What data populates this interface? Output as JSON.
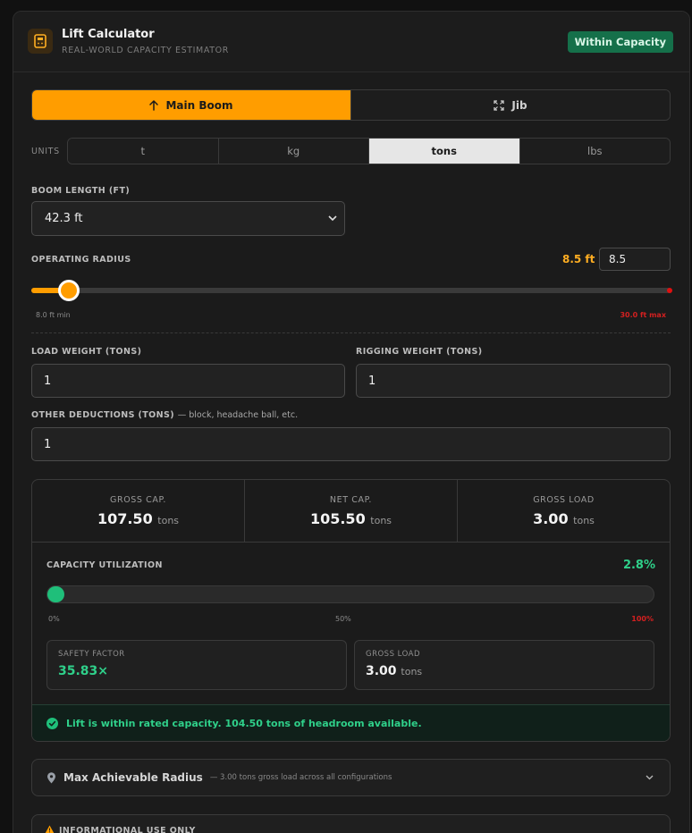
{
  "header": {
    "title": "Lift Calculator",
    "subtitle": "REAL-WORLD CAPACITY ESTIMATOR",
    "status": "Within Capacity"
  },
  "modes": [
    {
      "label": "Main Boom",
      "icon": "arrow-up-icon",
      "active": true
    },
    {
      "label": "Jib",
      "icon": "expand-icon",
      "active": false
    }
  ],
  "units": {
    "label": "UNITS",
    "options": [
      "t",
      "kg",
      "tons",
      "lbs"
    ],
    "selected": "tons"
  },
  "boom": {
    "label": "BOOM LENGTH (FT)",
    "value": "42.3 ft"
  },
  "radius": {
    "label": "OPERATING RADIUS",
    "display": "8.5 ft",
    "input_value": "8.5",
    "min_label": "8.0 ft min",
    "max_label": "30.0 ft max",
    "min": 8.0,
    "max": 30.0,
    "value": 8.5
  },
  "load": {
    "label": "LOAD WEIGHT (TONS)",
    "value": "1"
  },
  "rigging": {
    "label": "RIGGING WEIGHT (TONS)",
    "value": "1"
  },
  "other": {
    "label": "OTHER DEDUCTIONS (TONS)",
    "note": "— block, headache ball, etc.",
    "value": "1"
  },
  "stats": [
    {
      "label": "GROSS CAP.",
      "value": "107.50",
      "unit": "tons"
    },
    {
      "label": "NET CAP.",
      "value": "105.50",
      "unit": "tons"
    },
    {
      "label": "GROSS LOAD",
      "value": "3.00",
      "unit": "tons"
    }
  ],
  "utilization": {
    "label": "CAPACITY UTILIZATION",
    "percent_text": "2.8%",
    "percent": 2.8,
    "scale": [
      "0%",
      "50%",
      "100%"
    ]
  },
  "safety": {
    "label": "SAFETY FACTOR",
    "value": "35.83×"
  },
  "gross_load_card": {
    "label": "GROSS LOAD",
    "value": "3.00",
    "unit": "tons"
  },
  "alert": {
    "text": "Lift is within rated capacity. 104.50 tons of headroom available."
  },
  "max_radius": {
    "title": "Max Achievable Radius",
    "subtitle": "— 3.00 tons gross load across all configurations"
  },
  "info": {
    "title": "INFORMATIONAL USE ONLY"
  },
  "colors": {
    "accent": "#ff9d00",
    "success": "#1fbf7a",
    "danger": "#d42020"
  }
}
